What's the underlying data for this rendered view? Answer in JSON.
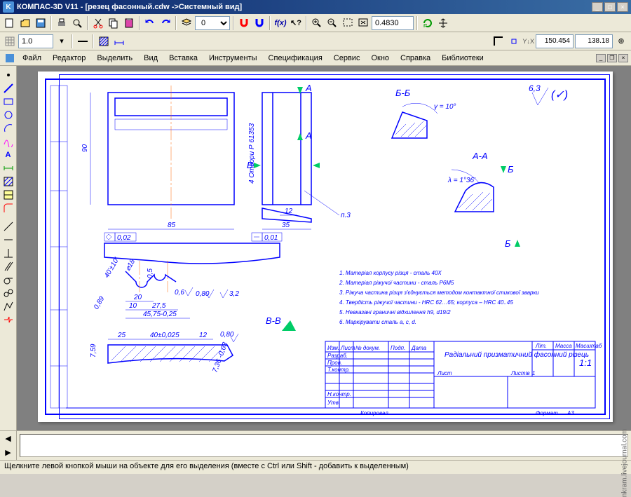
{
  "title": "КОМПАС-3D V11 - [резец фасонный.cdw ->Системный вид]",
  "zoom": "0.4830",
  "coord_x": "150.454",
  "coord_y": "138.18",
  "scale": "1.0",
  "menu": {
    "file": "Файл",
    "edit": "Редактор",
    "select": "Выделить",
    "view": "Вид",
    "insert": "Вставка",
    "tools": "Инструменты",
    "spec": "Спецификация",
    "service": "Сервис",
    "window": "Окно",
    "help": "Справка",
    "libs": "Библиотеки"
  },
  "status": "Щелкните левой кнопкой мыши на объекте для его выделения (вместе с Ctrl или Shift - добавить к выделенным)",
  "watermark": "nkram.livejournal.com",
  "drawing": {
    "dim_90": "90",
    "dim_85": "85",
    "dim_35": "35",
    "dim_12": "12",
    "dim_25": "25",
    "dim_40": "40±0,025",
    "dim_12b": "12",
    "dim_759": "7,59",
    "dim_20": "20",
    "dim_10": "10",
    "dim_275": "27,5",
    "dim_4575": "45,75-0,25",
    "dim_002": "0,02",
    "dim_001": "0,01",
    "dim_080": "0,80",
    "dim_32": "3,2",
    "dim_089": "0,89",
    "dim_05": "0,5",
    "dim_06": "0,6",
    "dim_d8": "⌀18",
    "dim_40toler": "40'±10'",
    "sec_A": "А",
    "sec_B": "В",
    "sec_Bb": "Б",
    "view_AA": "А-А",
    "view_BB": "Б-Б",
    "view_BBv": "В-В",
    "angle_gamma": "γ = 10°",
    "angle_lambda": "λ = 1°36'",
    "surface": "6,3",
    "note_p3": "п.3",
    "note_detail": "4 Отвори Р 61353",
    "notes": {
      "n1": "1. Матеріал корпусу різця - сталь 40Х",
      "n2": "2. Матеріал ріжучої частини - сталь Р6М5",
      "n3": "3. Ріжуча частина різця з'єднується методом контактної стикової зварки",
      "n4": "4. Твердість ріжучої частини - HRC 62…65; корпуса – HRC 40..45",
      "n5": "5. Невказані граничні відхилення h9, d19/2",
      "n6": "6. Маркірувати сталь a, c, d."
    },
    "title_block": {
      "name": "Радіальний призматичний фасонний різець",
      "lit": "Літ.",
      "massa": "Масса",
      "masshtab": "Масштаб",
      "scale": "1:1",
      "list": "Листів",
      "listn": "Лист",
      "n1": "1",
      "izm": "Изм.",
      "list2": "Лист",
      "ndokum": "№ докум.",
      "podp": "Подп.",
      "data": "Дата",
      "razrab": "Разраб.",
      "prov": "Пров.",
      "tkontr": "Т.контр.",
      "nkontr": "Н.контр.",
      "utv": "Утв.",
      "format": "Формат",
      "a3": "А3",
      "kopir": "Копировал"
    }
  }
}
